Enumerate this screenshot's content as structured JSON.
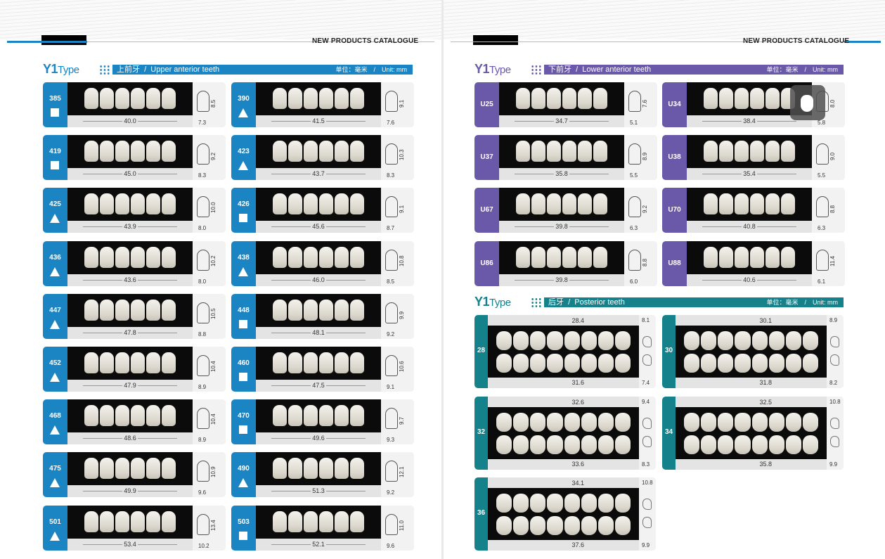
{
  "header": {
    "catalogue_label": "NEW PRODUCTS CATALOGUE"
  },
  "colors": {
    "blue": "#1b84c2",
    "purple": "#6a58a8",
    "teal": "#15818a"
  },
  "upper": {
    "title_y1": "Y1",
    "title_type": "Type",
    "cn": "上前牙",
    "en": "Upper anterior teeth",
    "unit": "单位：毫米　/　Unit: mm",
    "items": [
      {
        "code": "385",
        "shape": "square",
        "width": "40.0",
        "height": "8.5",
        "neck": "7.3"
      },
      {
        "code": "390",
        "shape": "triangle",
        "width": "41.5",
        "height": "9.1",
        "neck": "7.6"
      },
      {
        "code": "419",
        "shape": "square",
        "width": "45.0",
        "height": "9.2",
        "neck": "8.3"
      },
      {
        "code": "423",
        "shape": "triangle",
        "width": "43.7",
        "height": "10.3",
        "neck": "8.3"
      },
      {
        "code": "425",
        "shape": "triangle",
        "width": "43.9",
        "height": "10.0",
        "neck": "8.0"
      },
      {
        "code": "426",
        "shape": "square",
        "width": "45.6",
        "height": "9.1",
        "neck": "8.7"
      },
      {
        "code": "436",
        "shape": "triangle",
        "width": "43.6",
        "height": "10.2",
        "neck": "8.0"
      },
      {
        "code": "438",
        "shape": "triangle",
        "width": "46.0",
        "height": "10.8",
        "neck": "8.5"
      },
      {
        "code": "447",
        "shape": "triangle",
        "width": "47.8",
        "height": "10.5",
        "neck": "8.8"
      },
      {
        "code": "448",
        "shape": "square",
        "width": "48.1",
        "height": "9.9",
        "neck": "9.2"
      },
      {
        "code": "452",
        "shape": "triangle",
        "width": "47.9",
        "height": "10.4",
        "neck": "8.9"
      },
      {
        "code": "460",
        "shape": "square",
        "width": "47.5",
        "height": "10.6",
        "neck": "9.1"
      },
      {
        "code": "468",
        "shape": "triangle",
        "width": "48.6",
        "height": "10.4",
        "neck": "8.9"
      },
      {
        "code": "470",
        "shape": "square",
        "width": "49.6",
        "height": "9.7",
        "neck": "9.3"
      },
      {
        "code": "475",
        "shape": "triangle",
        "width": "49.9",
        "height": "10.9",
        "neck": "9.6"
      },
      {
        "code": "490",
        "shape": "triangle",
        "width": "51.3",
        "height": "12.1",
        "neck": "9.2"
      },
      {
        "code": "501",
        "shape": "triangle",
        "width": "53.4",
        "height": "13.4",
        "neck": "10.2"
      },
      {
        "code": "503",
        "shape": "square",
        "width": "52.1",
        "height": "11.0",
        "neck": "9.6"
      }
    ]
  },
  "lower": {
    "title_y1": "Y1",
    "title_type": "Type",
    "cn": "下前牙",
    "en": "Lower anterior teeth",
    "unit": "单位：毫米　/　Unit: mm",
    "items": [
      {
        "code": "U25",
        "width": "34.7",
        "height": "7.6",
        "neck": "5.1"
      },
      {
        "code": "U34",
        "width": "38.4",
        "height": "8.0",
        "neck": "5.8"
      },
      {
        "code": "U37",
        "width": "35.8",
        "height": "8.9",
        "neck": "5.5"
      },
      {
        "code": "U38",
        "width": "35.4",
        "height": "9.0",
        "neck": "5.5"
      },
      {
        "code": "U67",
        "width": "39.8",
        "height": "9.2",
        "neck": "6.3"
      },
      {
        "code": "U70",
        "width": "40.8",
        "height": "8.8",
        "neck": "6.3"
      },
      {
        "code": "U86",
        "width": "39.8",
        "height": "8.8",
        "neck": "6.0"
      },
      {
        "code": "U88",
        "width": "40.6",
        "height": "11.4",
        "neck": "6.1"
      }
    ]
  },
  "posterior": {
    "title_y1": "Y1",
    "title_type": "Type",
    "cn": "后牙",
    "en": "Posterior teeth",
    "unit": "单位：毫米　/　Unit: mm",
    "items": [
      {
        "code": "28",
        "top": "28.4",
        "bottom": "31.6",
        "side_top": "8.1",
        "side_bottom": "7.4"
      },
      {
        "code": "30",
        "top": "30.1",
        "bottom": "31.8",
        "side_top": "8.9",
        "side_bottom": "8.2"
      },
      {
        "code": "32",
        "top": "32.6",
        "bottom": "33.6",
        "side_top": "9.4",
        "side_bottom": "8.3"
      },
      {
        "code": "34",
        "top": "32.5",
        "bottom": "35.8",
        "side_top": "10.8",
        "side_bottom": "9.9"
      },
      {
        "code": "36",
        "top": "34.1",
        "bottom": "37.6",
        "side_top": "10.8",
        "side_bottom": "9.9"
      }
    ]
  }
}
